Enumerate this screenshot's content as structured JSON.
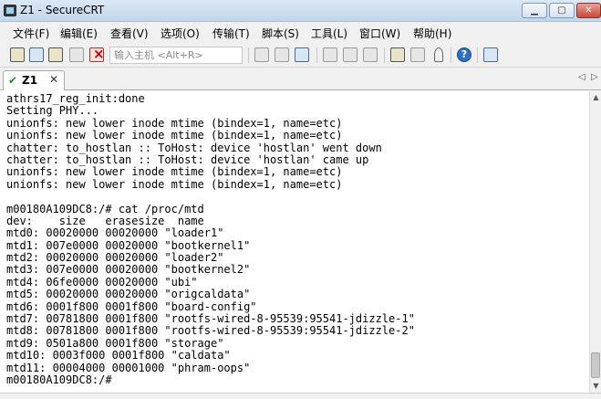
{
  "window": {
    "title": "Z1 - SecureCRT",
    "minimize_glyph": "▁",
    "maximize_glyph": "▢",
    "close_glyph": "✕"
  },
  "menu": [
    {
      "label": "文件(F)"
    },
    {
      "label": "编辑(E)"
    },
    {
      "label": "查看(V)"
    },
    {
      "label": "选项(O)"
    },
    {
      "label": "传输(T)"
    },
    {
      "label": "脚本(S)"
    },
    {
      "label": "工具(L)"
    },
    {
      "label": "窗口(W)"
    },
    {
      "label": "帮助(H)"
    }
  ],
  "toolbar": {
    "host_placeholder": "输入主机 <Alt+R>",
    "help_glyph": "?",
    "icons": [
      "connect-icon",
      "quick-connect-icon",
      "connect-tab-icon",
      "reconnect-icon",
      "disconnect-icon",
      "copy-icon",
      "paste-icon",
      "find-icon",
      "print-icon",
      "print-setup-icon",
      "session-options-icon",
      "global-options-icon",
      "keymap-icon",
      "help-icon",
      "sftp-icon"
    ]
  },
  "tab": {
    "check_glyph": "✔",
    "label": "Z1",
    "close_glyph": "✕",
    "nav_left": "◁",
    "nav_right": "▷"
  },
  "terminal": {
    "lines": [
      "athrs17_reg_init:done",
      "Setting PHY...",
      "unionfs: new lower inode mtime (bindex=1, name=etc)",
      "unionfs: new lower inode mtime (bindex=1, name=etc)",
      "chatter: to_hostlan :: ToHost: device 'hostlan' went down",
      "chatter: to_hostlan :: ToHost: device 'hostlan' came up",
      "unionfs: new lower inode mtime (bindex=1, name=etc)",
      "unionfs: new lower inode mtime (bindex=1, name=etc)",
      "",
      "m00180A109DC8:/# cat /proc/mtd",
      "dev:    size   erasesize  name",
      "mtd0: 00020000 00020000 \"loader1\"",
      "mtd1: 007e0000 00020000 \"bootkernel1\"",
      "mtd2: 00020000 00020000 \"loader2\"",
      "mtd3: 007e0000 00020000 \"bootkernel2\"",
      "mtd4: 06fe0000 00020000 \"ubi\"",
      "mtd5: 00020000 00020000 \"origcaldata\"",
      "mtd6: 0001f800 0001f800 \"board-config\"",
      "mtd7: 00781800 0001f800 \"rootfs-wired-8-95539:95541-jdizzle-1\"",
      "mtd8: 00781800 0001f800 \"rootfs-wired-8-95539:95541-jdizzle-2\"",
      "mtd9: 0501a800 0001f800 \"storage\"",
      "mtd10: 0003f000 0001f800 \"caldata\"",
      "mtd11: 00004000 00001000 \"phram-oops\"",
      "m00180A109DC8:/# "
    ]
  },
  "scrollbar": {
    "up_glyph": "▲",
    "down_glyph": "▼"
  }
}
